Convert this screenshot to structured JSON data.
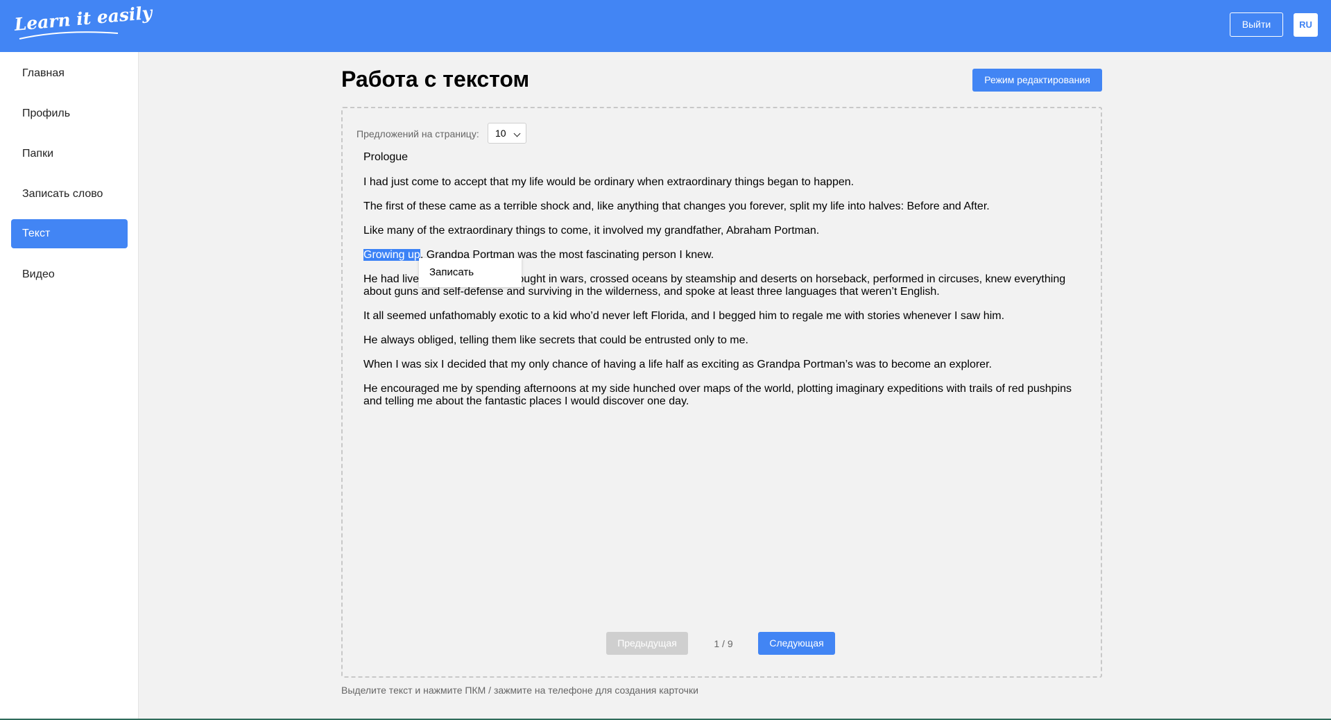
{
  "header": {
    "logo_text": "Learn it easily",
    "logout_label": "Выйти",
    "lang_label": "RU"
  },
  "sidebar": {
    "items": [
      {
        "label": "Главная"
      },
      {
        "label": "Профиль"
      },
      {
        "label": "Папки"
      },
      {
        "label": "Записать слово"
      },
      {
        "label": "Текст",
        "active": true
      },
      {
        "label": "Видео"
      }
    ]
  },
  "main": {
    "title": "Работа с текстом",
    "edit_mode_label": "Режим редактирования",
    "per_page_label": "Предложений на страницу:",
    "per_page_value": "10",
    "selected_text": "Growing up",
    "sentences": [
      "Prologue",
      "I had just come to accept that my life would be ordinary when extraordinary things began to happen.",
      "The first of these came as a terrible shock and, like anything that changes you forever, split my life into halves: Before and After.",
      "Like many of the extraordinary things to come, it involved my grandfather, Abraham Portman.",
      ", Grandpa Portman was the most fascinating person I knew.",
      "He had lived in an orphanage, fought in wars, crossed oceans by steamship and deserts on horseback, performed in circuses, knew everything about guns and self-defense and surviving in the wilderness, and spoke at least three languages that weren’t English.",
      "It all seemed unfathomably exotic to a kid who’d never left Florida, and I begged him to regale me with stories whenever I saw him.",
      "He always obliged, telling them like secrets that could be entrusted only to me.",
      "When I was six I decided that my only chance of having a life half as exciting as Grandpa Portman’s was to become an explorer.",
      "He encouraged me by spending afternoons at my side hunched over maps of the world, plotting imaginary expeditions with trails of red pushpins and telling me about the fantastic places I would discover one day."
    ],
    "context_menu_item": "Записать",
    "pagination": {
      "prev_label": "Предыдущая",
      "page_indicator": "1 / 9",
      "next_label": "Следующая"
    },
    "hint": "Выделите текст и нажмите ПКМ / зажмите на телефоне для создания карточки"
  },
  "colors": {
    "accent": "#4285f4",
    "highlight": "#3b82f6",
    "disabled": "#cfcfcf"
  }
}
